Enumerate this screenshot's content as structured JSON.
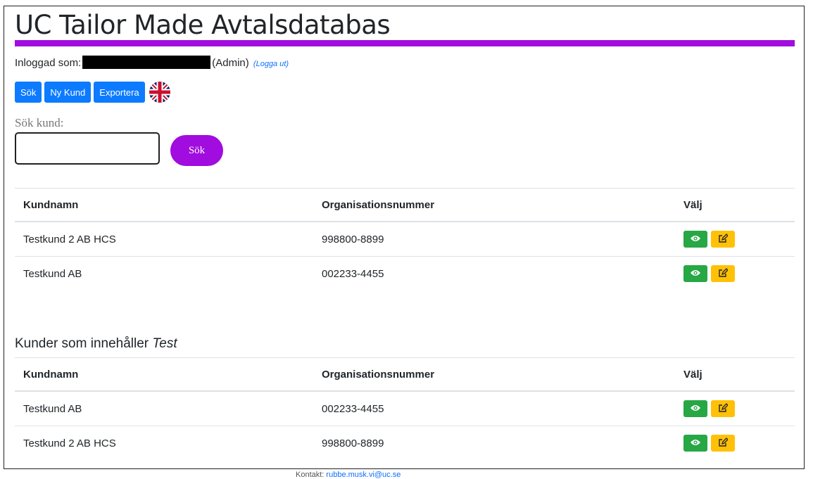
{
  "title": "UC Tailor Made Avtalsdatabas",
  "login": {
    "prefix": "Inloggad som:",
    "role": "(Admin)",
    "logout": "(Logga ut)"
  },
  "toolbar": {
    "search_label": "Sök",
    "new_customer_label": "Ny Kund",
    "export_label": "Exportera"
  },
  "search": {
    "label": "Sök kund:",
    "value": "",
    "button": "Sök"
  },
  "columns": {
    "name": "Kundnamn",
    "org": "Organisationsnummer",
    "choose": "Välj"
  },
  "table1": [
    {
      "name": "Testkund 2 AB HCS",
      "org": "998800-8899"
    },
    {
      "name": "Testkund AB",
      "org": "002233-4455"
    }
  ],
  "results_heading": {
    "prefix": "Kunder som innehåller ",
    "term": "Test"
  },
  "table2": [
    {
      "name": "Testkund AB",
      "org": "002233-4455"
    },
    {
      "name": "Testkund 2 AB HCS",
      "org": "998800-8899"
    }
  ],
  "footer": {
    "prefix": "Kontakt:",
    "link": "rubbe.musk.vi@uc.se"
  },
  "colors": {
    "accent": "#a10cdf",
    "primary": "#0d7bff",
    "view": "#28a745",
    "edit": "#ffc107"
  },
  "icons": {
    "view": "eye-icon",
    "edit": "edit-icon",
    "language": "uk-flag-icon"
  }
}
